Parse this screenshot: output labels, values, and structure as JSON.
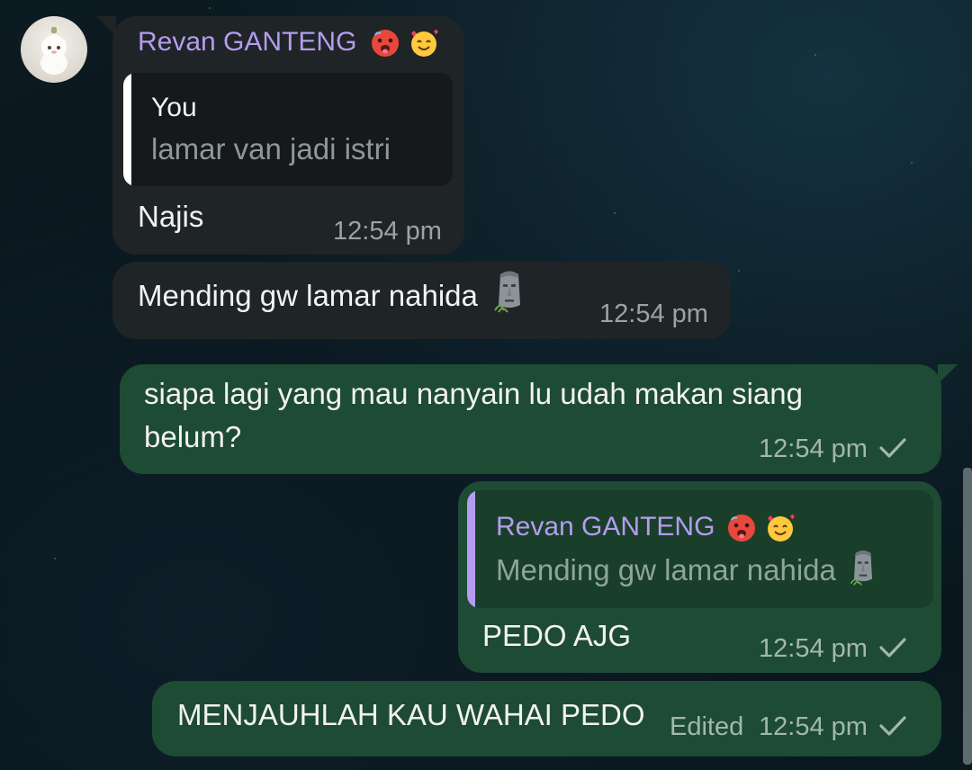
{
  "chat": {
    "messages": [
      {
        "direction": "incoming",
        "sender": "Revan GANTENG",
        "sender_emojis": [
          "hot-face-emoji",
          "smiling-face-with-hearts-emoji"
        ],
        "reply_to": {
          "author": "You",
          "text": "lamar van jadi istri"
        },
        "text": "Najis",
        "time": "12:54 pm"
      },
      {
        "direction": "incoming",
        "text": "Mending gw lamar nahida",
        "trailing_emoji": "moai-emoji",
        "time": "12:54 pm"
      },
      {
        "direction": "outgoing",
        "text_line1": "siapa lagi yang mau nanyain lu udah makan siang",
        "text_line2": "belum?",
        "time": "12:54 pm",
        "status": "sent-check-icon"
      },
      {
        "direction": "outgoing",
        "reply_to": {
          "author": "Revan GANTENG",
          "author_emojis": [
            "hot-face-emoji",
            "smiling-face-with-hearts-emoji"
          ],
          "text": "Mending gw lamar nahida",
          "trailing_emoji": "moai-emoji"
        },
        "text": "PEDO AJG",
        "time": "12:54 pm",
        "status": "sent-check-icon"
      },
      {
        "direction": "outgoing",
        "text": "MENJAUHLAH KAU WAHAI PEDO",
        "edited_label": "Edited",
        "time": "12:54 pm",
        "status": "sent-check-icon"
      }
    ]
  },
  "colors": {
    "incoming_bubble": "#1f2426",
    "outgoing_bubble": "#1e4b33",
    "sender_name": "#b49cf0",
    "quote_bar_incoming": "#ffffff",
    "quote_bar_outgoing": "#b49cf0"
  }
}
